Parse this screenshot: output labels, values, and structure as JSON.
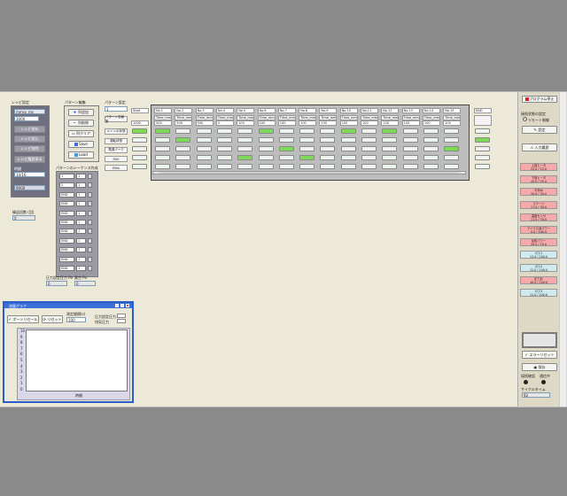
{
  "timer_panel": {
    "title": "レシピ設定",
    "header_field": "mmss_ms",
    "value_field": "3000",
    "buttons": [
      "レシピ保存",
      "レシピ読込",
      "レシピ削除",
      "レシピ履歴表示"
    ],
    "sub_label": "時間",
    "field_b": "10/16",
    "field_c": "9000"
  },
  "pattern_ops": {
    "title": "パターン編集",
    "buttons": [
      "列追加",
      "列削除",
      "列クリア",
      "Save",
      "Load"
    ]
  },
  "pattern_setting": {
    "title": "パターン設定",
    "number_field": "1",
    "row_labels": [
      "パターン名編集",
      "メインの状態",
      "運転状態",
      "電源バーク",
      "RS0",
      "RMA"
    ]
  },
  "first_column": {
    "name_field": "Start",
    "value_field": "1000"
  },
  "grid": {
    "columns": [
      {
        "no": "No.1",
        "time_label": "Time_mm",
        "value": "500"
      },
      {
        "no": "No.2",
        "time_label": "Time_mm",
        "value": "500"
      },
      {
        "no": "No.3",
        "time_label": "Time_mm",
        "value": "500"
      },
      {
        "no": "No.4",
        "time_label": "Time_mm",
        "value": "0"
      },
      {
        "no": "No.5",
        "time_label": "Time_mm",
        "value": "100"
      },
      {
        "no": "No.6",
        "time_label": "Time_mm",
        "value": "100"
      },
      {
        "no": "No.7",
        "time_label": "Time_mm",
        "value": "100"
      },
      {
        "no": "No.8",
        "time_label": "Time_mm",
        "value": "100"
      },
      {
        "no": "No.9",
        "time_label": "Time_mm",
        "value": "100"
      },
      {
        "no": "No.10",
        "time_label": "Time_mm",
        "value": "100"
      },
      {
        "no": "No.11",
        "time_label": "Time_mm",
        "value": "100"
      },
      {
        "no": "No.12",
        "time_label": "Time_mm",
        "value": "100"
      },
      {
        "no": "No.13",
        "time_label": "Time_mm",
        "value": "100"
      },
      {
        "no": "No.14",
        "time_label": "Time_mm",
        "value": "100"
      },
      {
        "no": "No.15",
        "time_label": "Time_mm",
        "value": "100"
      }
    ],
    "end_label": "END"
  },
  "sequence_panel": {
    "title": "パターンのシーケンス作成",
    "rows": [
      {
        "a": "1",
        "b": "1"
      },
      {
        "a": "2",
        "b": "1"
      },
      {
        "a": "END",
        "b": "1"
      },
      {
        "a": "END",
        "b": "1"
      },
      {
        "a": "END",
        "b": "1"
      },
      {
        "a": "END",
        "b": "1"
      },
      {
        "a": "END",
        "b": "1"
      },
      {
        "a": "END",
        "b": "1"
      },
      {
        "a": "END",
        "b": "1"
      },
      {
        "a": "END",
        "b": "1"
      },
      {
        "a": "END",
        "b": "1"
      }
    ]
  },
  "misc": {
    "count_label": "繰返回数 (回)",
    "count_value": "0",
    "pressure_label": "圧力設定圧力 Pa",
    "pressure_value": "0",
    "vacuum_label": "真空 Pa",
    "vacuum_value": "0"
  },
  "graph_window": {
    "title": "流量グラフ",
    "buttons": [
      "ポートリセール",
      "リセット"
    ],
    "interval_label": "測定間隔(s)",
    "interval_value": "100",
    "legend": [
      "圧力設定圧力",
      "排気圧力"
    ],
    "y_ticks": [
      "10",
      "9",
      "8",
      "7",
      "6",
      "5",
      "4",
      "3",
      "2",
      "1",
      "0"
    ],
    "x_label": "時間"
  },
  "right_panel": {
    "run_button": "プログラム停止",
    "status_title": "接続状態の設定",
    "radio_label": "リモート制御",
    "set_button": "設定",
    "history_button": "入力履歴",
    "badges": [
      {
        "line1": "上部ヒータ",
        "line2": "22.0 / 22.0",
        "color": "p"
      },
      {
        "line1": "下部ヒータ",
        "line2": "45.0 / 45.0",
        "color": "p"
      },
      {
        "line1": "冷却水",
        "line2": "30.0 / 30.0",
        "color": "p"
      },
      {
        "line1": "ステージ",
        "line2": "17.0 / 30.0",
        "color": "p"
      },
      {
        "line1": "温度センサ",
        "line2": "11.0 / 30.0",
        "color": "p"
      },
      {
        "line1": "マイクロ波パワー",
        "line2": "0.0 / 100.0",
        "color": "p"
      },
      {
        "line1": "反射パワー",
        "line2": "30.0 / 10.0",
        "color": "p"
      },
      {
        "line1": "ガス1",
        "line2": "12.0 / 100.0",
        "color": "c"
      },
      {
        "line1": "ガス2",
        "line2": "12.0 / 100.0",
        "color": "c"
      },
      {
        "line1": "圧力計",
        "line2": "40.0 / 100.0",
        "color": "p"
      },
      {
        "line1": "ガス3",
        "line2": "12.0 / 100.0",
        "color": "c"
      }
    ],
    "error_reset_button": "エラーリセット",
    "save_button": "保存",
    "indicator_labels": [
      "接続確認",
      "通信中"
    ],
    "cycle_label": "サイクルタイム",
    "cycle_value": "92"
  }
}
